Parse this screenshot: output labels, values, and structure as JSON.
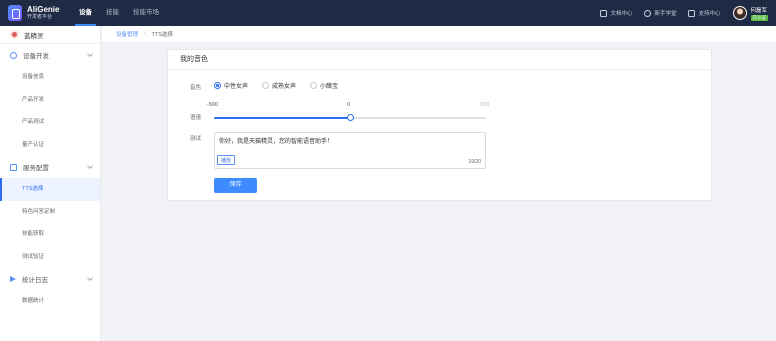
{
  "header": {
    "logo_title": "AliGenie",
    "logo_subtitle": "开发者平台",
    "nav": [
      "设备",
      "技能",
      "技能市场"
    ],
    "links": [
      {
        "label": "文档中心",
        "icon": "document-icon"
      },
      {
        "label": "新手学堂",
        "icon": "help-icon"
      },
      {
        "label": "支持中心",
        "icon": "support-icon"
      }
    ],
    "user_name": "何磊军",
    "user_badge": "已认证"
  },
  "sidebar": {
    "brand": "蓝精灵",
    "groups": [
      {
        "label": "设备开发",
        "items": [
          "设备信息",
          "产品开发",
          "产品测试",
          "量产认证"
        ]
      },
      {
        "label": "服务配置",
        "items": [
          "TTS选择",
          "特色问答定制",
          "技能获取",
          "测试验证"
        ]
      },
      {
        "label": "统计日志",
        "items": [
          "数据统计"
        ]
      }
    ],
    "active_item": "TTS选择"
  },
  "breadcrumb": {
    "parent": "设备管理",
    "current": "TTS选择"
  },
  "card": {
    "title": "我的音色",
    "voice_label": "音色",
    "voice_options": [
      "中性女声",
      "成熟女声",
      "小醋宝"
    ],
    "voice_selected": "中性女声",
    "speed_label": "语速",
    "speed_min": "-500",
    "speed_value": "0",
    "speed_max": "500",
    "speed_fraction": 0.5,
    "test_label": "测试",
    "test_text": "你好，我是天猫精灵，您的智能语音助手！",
    "play_label": "播放",
    "char_count": "19/20",
    "save_label": "保存"
  },
  "colors": {
    "accent": "#2d6ef5",
    "topbar": "#1f2a44",
    "button": "#3d8bff"
  }
}
